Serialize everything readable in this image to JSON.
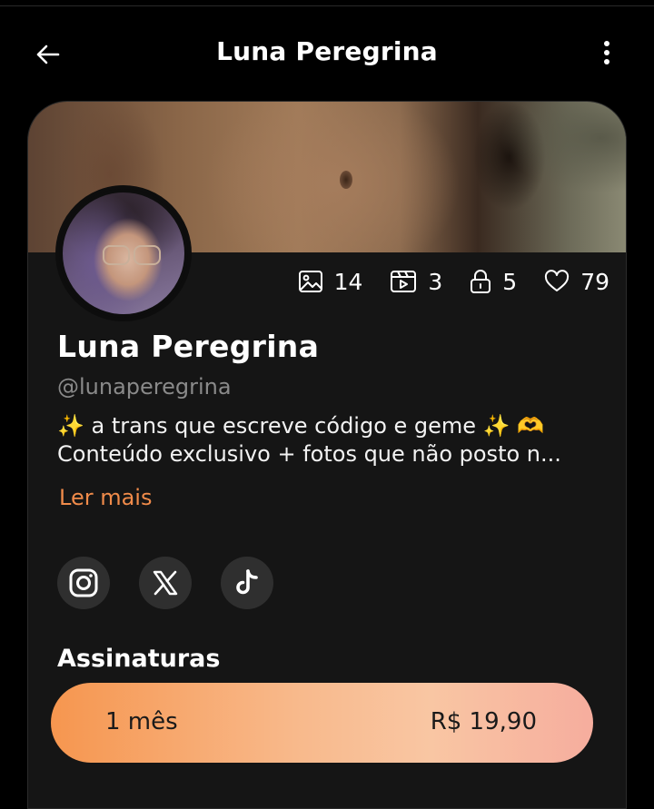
{
  "header": {
    "title": "Luna Peregrina",
    "back_icon": "arrow-left-icon",
    "more_icon": "more-vertical-icon"
  },
  "profile": {
    "name": "Luna Peregrina",
    "handle": "@lunaperegrina",
    "bio_line1": "✨ a trans que escreve código e geme ✨ 🫶",
    "bio_line2": "Conteúdo exclusivo + fotos que não posto n...",
    "read_more": "Ler mais"
  },
  "stats": [
    {
      "icon": "image-icon",
      "value": "14"
    },
    {
      "icon": "video-icon",
      "value": "3"
    },
    {
      "icon": "lock-icon",
      "value": "5"
    },
    {
      "icon": "heart-icon",
      "value": "79"
    }
  ],
  "socials": [
    {
      "icon": "instagram-icon"
    },
    {
      "icon": "x-icon"
    },
    {
      "icon": "tiktok-icon"
    }
  ],
  "subscriptions": {
    "title": "Assinaturas",
    "plans": [
      {
        "label": "1 mês",
        "price": "R$ 19,90"
      }
    ]
  },
  "colors": {
    "accent": "#f08b4a",
    "background": "#000000",
    "card": "#151515"
  }
}
